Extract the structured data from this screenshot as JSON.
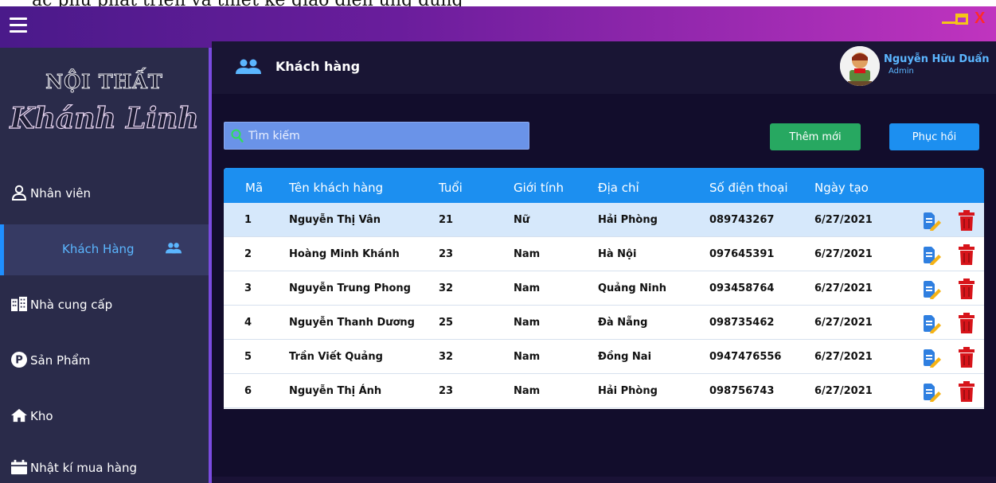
{
  "window": {
    "caption_strip": "ặc phụ phát triển và thiết kế giao diện ứng dụng"
  },
  "sidebar": {
    "logo_top": "NỘI THẤT",
    "logo_bottom": "Khánh Linh",
    "items": [
      {
        "label": "Nhân viên",
        "icon": "user-icon"
      },
      {
        "label": "Khách Hàng",
        "icon": "users-icon",
        "active": true
      },
      {
        "label": "Nhà cung cấp",
        "icon": "building-icon"
      },
      {
        "label": "Sản Phẩm",
        "icon": "product-p-icon"
      },
      {
        "label": "Kho",
        "icon": "home-icon"
      },
      {
        "label": "Nhật kí mua hàng",
        "icon": "calendar-icon"
      }
    ]
  },
  "header": {
    "title": "Khách hàng",
    "user_name": "Nguyễn Hữu Duẩn",
    "user_role": "Admin"
  },
  "toolbar": {
    "search_placeholder": "Tìm kiếm",
    "add_label": "Thêm mới",
    "restore_label": "Phục hồi"
  },
  "table": {
    "columns": [
      "Mã",
      "Tên khách hàng",
      "Tuổi",
      "Giới tính",
      "Địa chỉ",
      "Số điện thoại",
      "Ngày tạo"
    ],
    "rows": [
      [
        "1",
        "Nguyễn Thị Vân",
        "21",
        "Nữ",
        "Hải Phòng",
        "089743267",
        "6/27/2021"
      ],
      [
        "2",
        "Hoàng Minh Khánh",
        "23",
        "Nam",
        "Hà Nội",
        "097645391",
        "6/27/2021"
      ],
      [
        "3",
        "Nguyễn Trung Phong",
        "32",
        "Nam",
        "Quảng Ninh",
        "093458764",
        "6/27/2021"
      ],
      [
        "4",
        "Nguyễn Thanh Dương",
        "25",
        "Nam",
        "Đà Nẵng",
        "098735462",
        "6/27/2021"
      ],
      [
        "5",
        "Trần Viết Quảng",
        "32",
        "Nam",
        "Đồng Nai",
        "0947476556",
        "6/27/2021"
      ],
      [
        "6",
        "Nguyễn Thị Ánh",
        "23",
        "Nam",
        "Hải Phòng",
        "098756743",
        "6/27/2021"
      ]
    ],
    "row_actions": [
      "edit-icon",
      "delete-icon"
    ]
  },
  "colors": {
    "titlebar_start": "#4a1a8a",
    "titlebar_end": "#c034bf",
    "sidebar_bg": "#2a2b4a",
    "accent_blue": "#1c8ff0",
    "add_green": "#27a861",
    "delete_red": "#d7141a",
    "window_control_yellow": "#f5c518"
  }
}
